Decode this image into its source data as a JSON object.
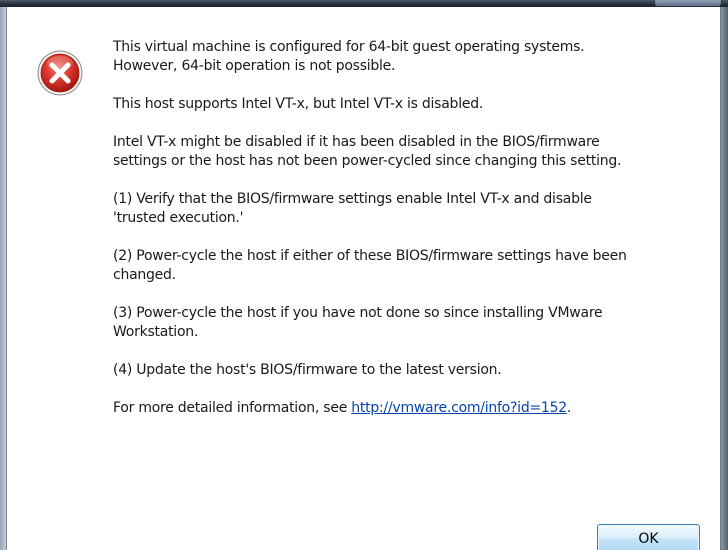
{
  "dialog": {
    "icon": "error-icon",
    "message": {
      "p1_l1": "This virtual machine is configured for 64-bit guest operating systems.",
      "p1_l2": "However, 64-bit operation is not possible.",
      "p2_l1": "This host supports Intel VT-x, but Intel VT-x is disabled.",
      "p3_l1": "Intel VT-x might be disabled if it has been disabled in the BIOS/firmware",
      "p3_l2": "settings or the host has not been power-cycled since changing this setting.",
      "p4_l1": "(1) Verify that the BIOS/firmware settings enable Intel VT-x and disable",
      "p4_l2": "'trusted execution.'",
      "p5_l1": "(2) Power-cycle the host if either of these BIOS/firmware settings have been",
      "p5_l2": "changed.",
      "p6_l1": "(3) Power-cycle the host if you have not done so since installing VMware",
      "p6_l2": "Workstation.",
      "p7_l1": "(4) Update the host's BIOS/firmware to the latest version.",
      "p8_prefix": "For more detailed information, see ",
      "p8_link": "http://vmware.com/info?id=152",
      "p8_suffix": "."
    },
    "ok_label": "OK"
  },
  "colors": {
    "error_red": "#c4261d",
    "link": "#0645ad",
    "text": "#1a1a1a",
    "button_border": "#3c7fb1"
  }
}
